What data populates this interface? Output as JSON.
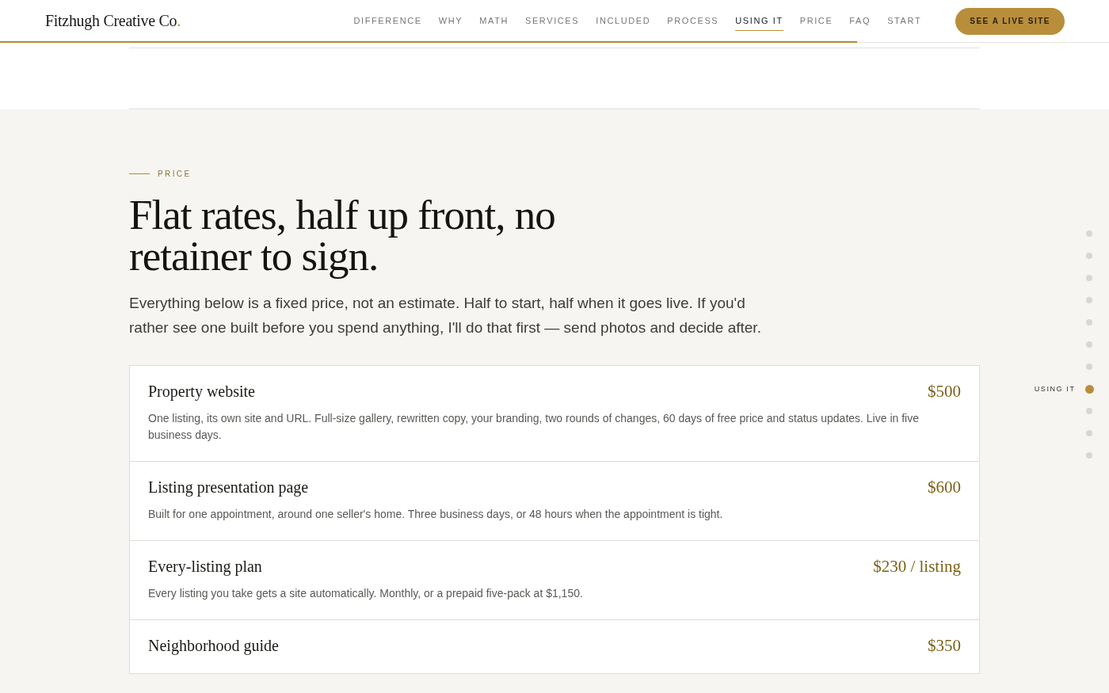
{
  "header": {
    "logo": "Fitzhugh Creative Co",
    "logo_mark": ".",
    "nav": [
      {
        "label": "DIFFERENCE",
        "selected": false
      },
      {
        "label": "WHY",
        "selected": false
      },
      {
        "label": "MATH",
        "selected": false
      },
      {
        "label": "SERVICES",
        "selected": false
      },
      {
        "label": "INCLUDED",
        "selected": false
      },
      {
        "label": "PROCESS",
        "selected": false
      },
      {
        "label": "USING IT",
        "selected": true
      },
      {
        "label": "PRICE",
        "selected": false
      },
      {
        "label": "FAQ",
        "selected": false
      },
      {
        "label": "START",
        "selected": false
      }
    ],
    "cta": "SEE A LIVE SITE",
    "scroll_progress": {
      "level": 0.773
    }
  },
  "section": {
    "eyebrow": "PRICE",
    "heading": "Flat rates, half up front, no retainer to sign.",
    "intro": "Everything below is a fixed price, not an estimate. Half to start, half when it goes live. If you'd rather see one built before you spend anything, I'll do that first — send photos and decide after.",
    "prices": [
      {
        "name": "Property website",
        "price": "$500",
        "description": "One listing, its own site and URL. Full-size gallery, rewritten copy, your branding, two rounds of changes, 60 days of free price and status updates. Live in five business days."
      },
      {
        "name": "Listing presentation page",
        "price": "$600",
        "description": "Built for one appointment, around one seller's home. Three business days, or 48 hours when the appointment is tight."
      },
      {
        "name": "Every-listing plan",
        "price": "$230 / listing",
        "description": "Every listing you take gets a site automatically. Monthly, or a prepaid five-pack at $1,150."
      },
      {
        "name": "Neighborhood guide",
        "price": "$350"
      }
    ]
  },
  "side_nav": [
    {
      "selected": false
    },
    {
      "selected": false
    },
    {
      "selected": false
    },
    {
      "selected": false
    },
    {
      "selected": false
    },
    {
      "selected": false
    },
    {
      "selected": false
    },
    {
      "label": "USING IT",
      "selected": true
    },
    {
      "selected": false
    },
    {
      "selected": false
    },
    {
      "selected": false
    }
  ]
}
